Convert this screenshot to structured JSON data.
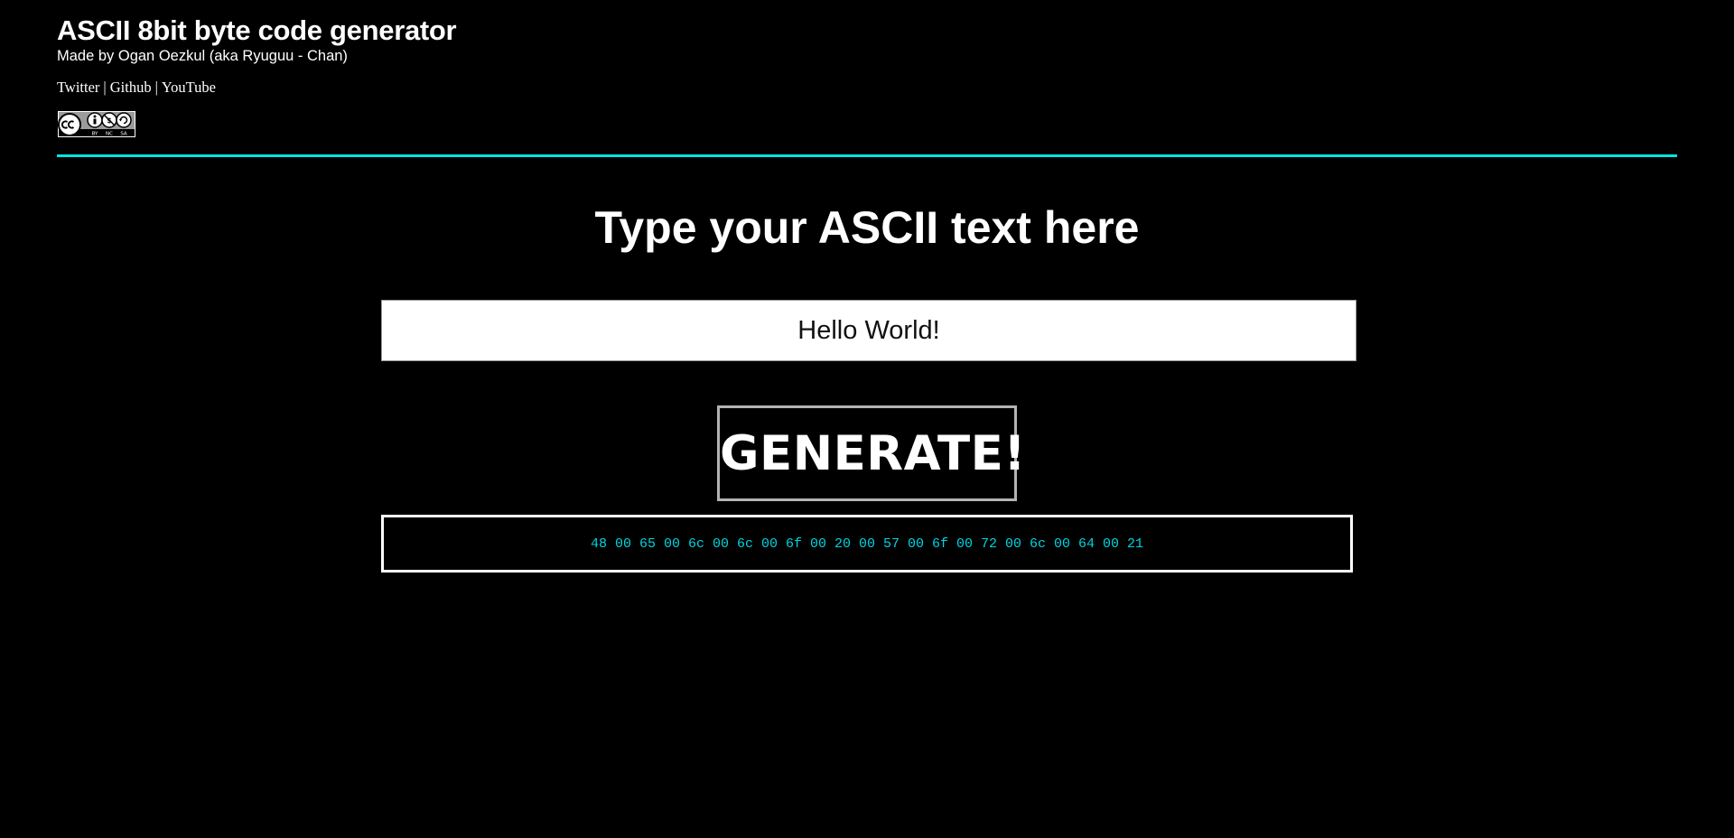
{
  "header": {
    "title": "ASCII 8bit byte code generator",
    "credit": "Made by Ogan Oezkul (aka Ryuguu - Chan)",
    "links": [
      {
        "label": "Twitter"
      },
      {
        "label": "Github"
      },
      {
        "label": "YouTube"
      }
    ],
    "separator": "|",
    "license_badge": {
      "icon": "cc-by-nc-sa-icon",
      "labels": [
        "BY",
        "NC",
        "SA"
      ]
    }
  },
  "main": {
    "heading": "Type your ASCII text here",
    "input": {
      "value": "Hello World!"
    },
    "generate_label": "GENERATE!",
    "output": "48 00 65 00 6c 00 6c 00 6f 00 20 00 57 00 6f 00 72 00 6c 00 64 00 21"
  },
  "colors": {
    "background": "#000000",
    "accent": "#00e5e5",
    "output_text": "#00d4e0",
    "text": "#ffffff"
  }
}
